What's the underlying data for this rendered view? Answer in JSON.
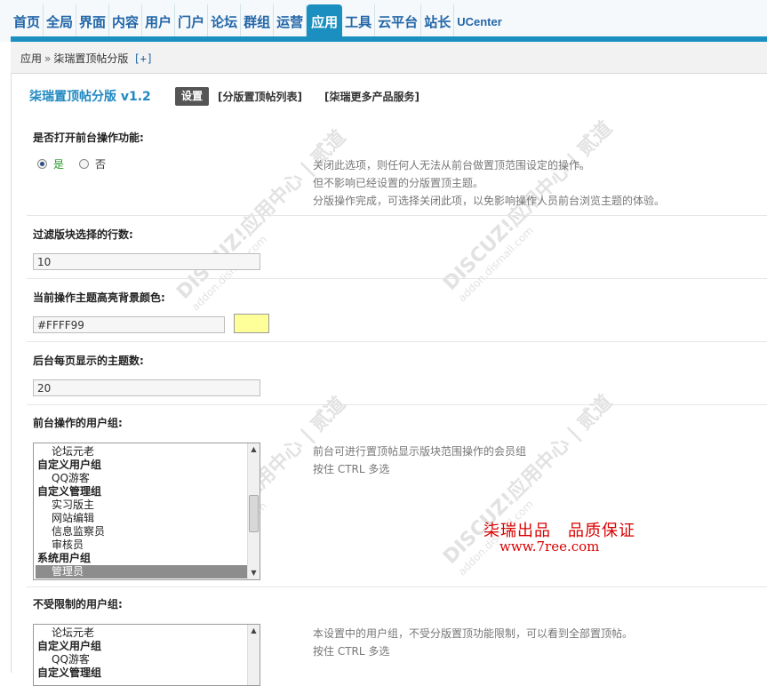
{
  "nav": {
    "tabs": [
      "首页",
      "全局",
      "界面",
      "内容",
      "用户",
      "门户",
      "论坛",
      "群组",
      "运营",
      "应用",
      "工具",
      "云平台",
      "站长",
      "UCenter"
    ],
    "active": "应用"
  },
  "breadcrumb": {
    "root": "应用",
    "sep": "»",
    "current": "柒瑞置顶帖分版",
    "plus": "[+]"
  },
  "plugin": {
    "title": "柒瑞置顶帖分版 v1.2",
    "tab_settings": "设置",
    "tab_list": "[分版置顶帖列表]",
    "tab_more": "[柒瑞更多产品服务]"
  },
  "settings": {
    "frontend_op": {
      "label": "是否打开前台操作功能:",
      "yes": "是",
      "no": "否",
      "hint1": "关闭此选项，则任何人无法从前台做置顶范围设定的操作。",
      "hint2": "但不影响已经设置的分版置顶主题。",
      "hint3": "分版操作完成，可选择关闭此项，以免影响操作人员前台浏览主题的体验。"
    },
    "filter_rows": {
      "label": "过滤版块选择的行数:",
      "value": "10"
    },
    "highlight_color": {
      "label": "当前操作主题高亮背景颜色:",
      "value": "#FFFF99",
      "color": "#FFFF99"
    },
    "per_page": {
      "label": "后台每页显示的主题数:",
      "value": "20"
    },
    "front_groups": {
      "label": "前台操作的用户组:",
      "hint1": "前台可进行置顶帖显示版块范围操作的会员组",
      "hint2": "按住 CTRL 多选",
      "items": [
        "论坛元老",
        "自定义用户组",
        "QQ游客",
        "自定义管理组",
        "实习版主",
        "网站编辑",
        "信息监察员",
        "审核员",
        "系统用户组",
        "管理员"
      ]
    },
    "unlimited_groups": {
      "label": "不受限制的用户组:",
      "hint1": "本设置中的用户组，不受分版置顶功能限制，可以看到全部置顶帖。",
      "hint2": "按住 CTRL 多选",
      "items": [
        "论坛元老",
        "自定义用户组",
        "QQ游客",
        "自定义管理组"
      ]
    }
  },
  "brand": {
    "line1": "柒瑞出品　品质保证",
    "line2": "www.7ree.com"
  },
  "watermark": {
    "main": "DISCUZ!应用中心 | 贰道",
    "sub": "addon.dismall.com"
  }
}
